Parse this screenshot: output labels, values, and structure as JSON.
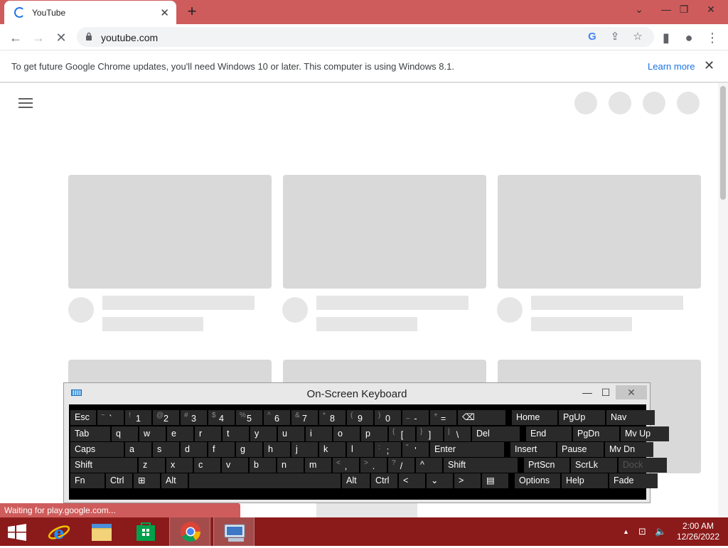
{
  "browser": {
    "tab_title": "YouTube",
    "tab_close": "✕",
    "new_tab": "+",
    "window_controls": {
      "minimize": "—",
      "restore": "❐",
      "close": "✕",
      "dropdown": "⌄"
    },
    "url": "youtube.com",
    "nav": {
      "back": "←",
      "forward": "→",
      "reload_stop": "✕"
    },
    "toolbar_icons": {
      "google": "G",
      "share": "⇪",
      "bookmark": "☆",
      "side_panel": "▮",
      "profile": "●",
      "menu": "⋮"
    }
  },
  "infobar": {
    "message": "To get future Google Chrome updates, you'll need Windows 10 or later. This computer is using Windows 8.1.",
    "learn_more": "Learn more",
    "close": "✕"
  },
  "status_bar": "Waiting for play.google.com...",
  "osk": {
    "title": "On-Screen Keyboard",
    "minimize": "—",
    "maximize": "☐",
    "close": "✕",
    "rows": [
      [
        {
          "l": "Esc"
        },
        {
          "s": "~",
          "l": "`"
        },
        {
          "s": "!",
          "l": "1"
        },
        {
          "s": "@",
          "l": "2"
        },
        {
          "s": "#",
          "l": "3"
        },
        {
          "s": "$",
          "l": "4"
        },
        {
          "s": "%",
          "l": "5"
        },
        {
          "s": "^",
          "l": "6"
        },
        {
          "s": "&",
          "l": "7"
        },
        {
          "s": "*",
          "l": "8"
        },
        {
          "s": "(",
          "l": "9"
        },
        {
          "s": ")",
          "l": "0"
        },
        {
          "s": "_",
          "l": "-"
        },
        {
          "s": "+",
          "l": "="
        },
        {
          "l": "⌫"
        },
        {
          "l": "Home"
        },
        {
          "l": "PgUp"
        },
        {
          "l": "Nav"
        }
      ],
      [
        {
          "l": "Tab"
        },
        {
          "l": "q"
        },
        {
          "l": "w"
        },
        {
          "l": "e"
        },
        {
          "l": "r"
        },
        {
          "l": "t"
        },
        {
          "l": "y"
        },
        {
          "l": "u"
        },
        {
          "l": "i"
        },
        {
          "l": "o"
        },
        {
          "l": "p"
        },
        {
          "s": "{",
          "l": "["
        },
        {
          "s": "}",
          "l": "]"
        },
        {
          "s": "|",
          "l": "\\"
        },
        {
          "l": "Del"
        },
        {
          "l": "End"
        },
        {
          "l": "PgDn"
        },
        {
          "l": "Mv Up"
        }
      ],
      [
        {
          "l": "Caps"
        },
        {
          "l": "a"
        },
        {
          "l": "s"
        },
        {
          "l": "d"
        },
        {
          "l": "f"
        },
        {
          "l": "g"
        },
        {
          "l": "h"
        },
        {
          "l": "j"
        },
        {
          "l": "k"
        },
        {
          "l": "l"
        },
        {
          "s": ":",
          "l": ";"
        },
        {
          "s": "\"",
          "l": "'"
        },
        {
          "l": "Enter"
        },
        {
          "l": "Insert"
        },
        {
          "l": "Pause"
        },
        {
          "l": "Mv Dn"
        }
      ],
      [
        {
          "l": "Shift"
        },
        {
          "l": "z"
        },
        {
          "l": "x"
        },
        {
          "l": "c"
        },
        {
          "l": "v"
        },
        {
          "l": "b"
        },
        {
          "l": "n"
        },
        {
          "l": "m"
        },
        {
          "s": "<",
          "l": ","
        },
        {
          "s": ">",
          "l": "."
        },
        {
          "s": "?",
          "l": "/"
        },
        {
          "l": "^"
        },
        {
          "l": "Shift"
        },
        {
          "l": "PrtScn"
        },
        {
          "l": "ScrLk"
        },
        {
          "l": "Dock"
        }
      ],
      [
        {
          "l": "Fn"
        },
        {
          "l": "Ctrl"
        },
        {
          "l": "⊞"
        },
        {
          "l": "Alt"
        },
        {
          "l": ""
        },
        {
          "l": "Alt"
        },
        {
          "l": "Ctrl"
        },
        {
          "l": "<"
        },
        {
          "l": "⌄"
        },
        {
          "l": ">"
        },
        {
          "l": "▤"
        },
        {
          "l": "Options"
        },
        {
          "l": "Help"
        },
        {
          "l": "Fade"
        }
      ]
    ]
  },
  "taskbar": {
    "time": "2:00 AM",
    "date": "12/26/2022",
    "tray": {
      "chevron": "▲",
      "network": "⊡",
      "volume": "🔈"
    }
  },
  "colors": {
    "titlebar": "#cf5c5c",
    "taskbar": "#8b1a1a",
    "skeleton": "#d9d9d9"
  }
}
